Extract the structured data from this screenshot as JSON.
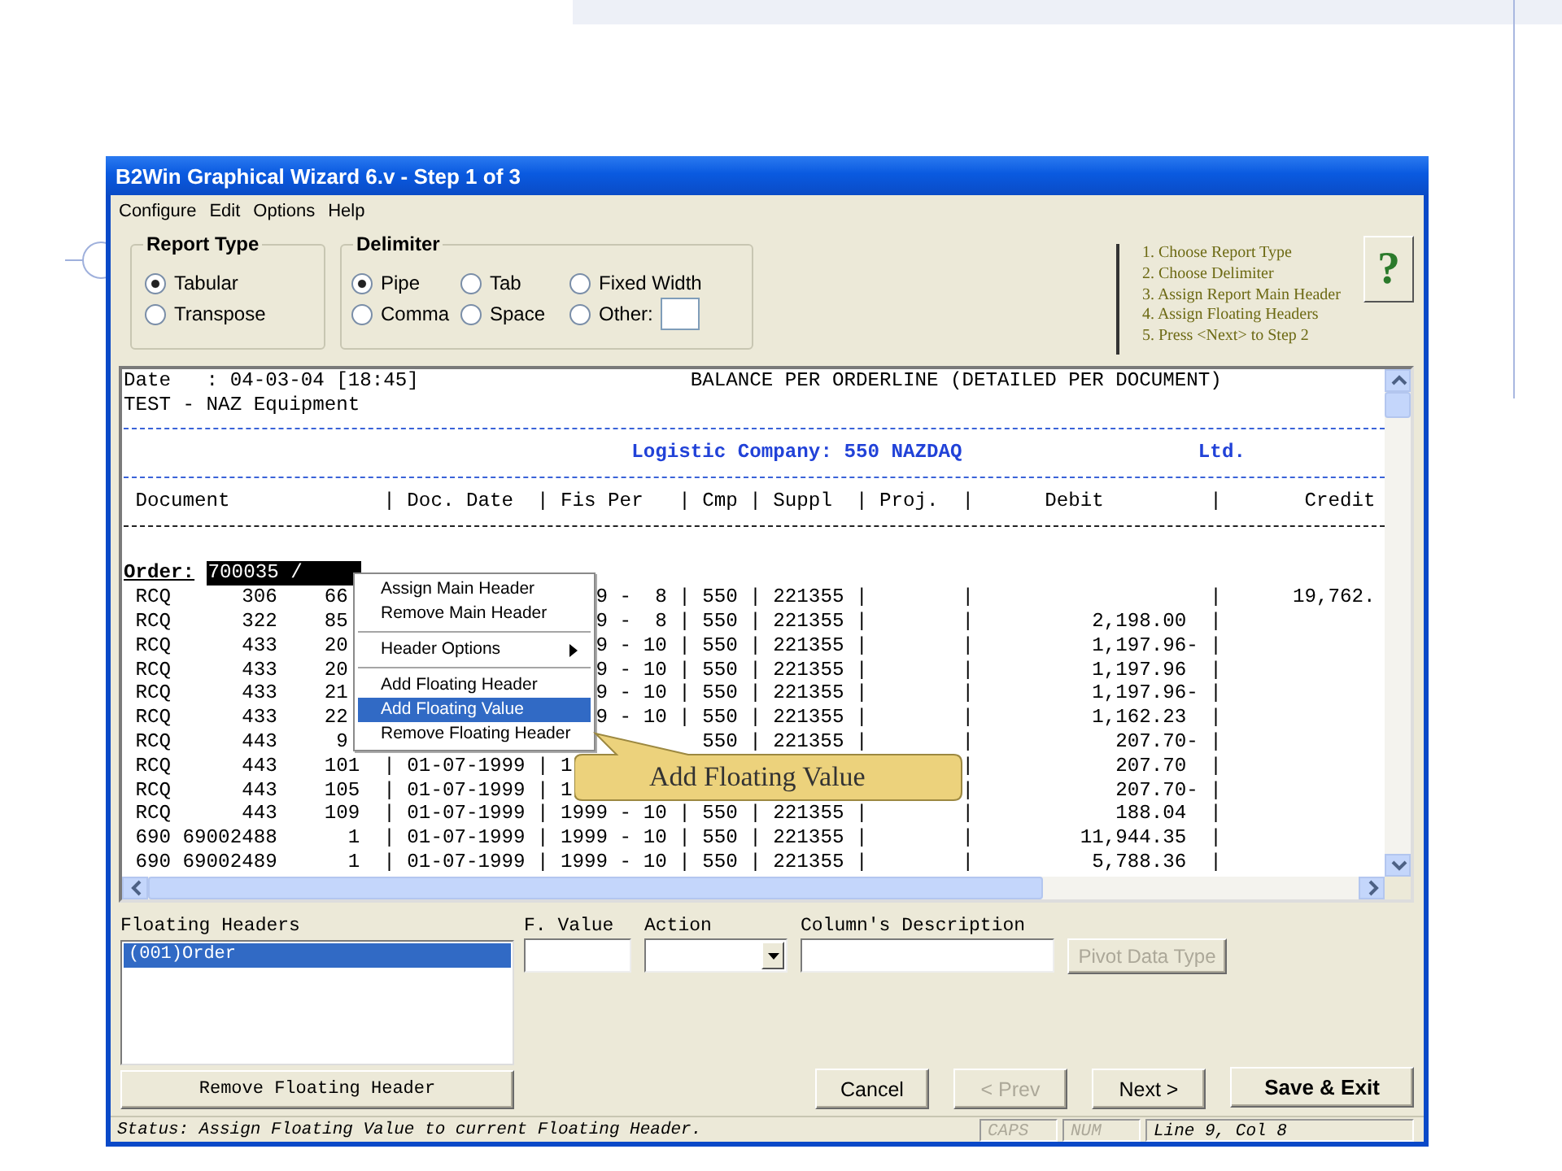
{
  "window": {
    "title": "B2Win Graphical Wizard 6.v - Step 1 of 3"
  },
  "menu_bar": [
    "Configure",
    "Edit",
    "Options",
    "Help"
  ],
  "report_type": {
    "label": "Report Type",
    "options": [
      {
        "label": "Tabular",
        "selected": true
      },
      {
        "label": "Transpose",
        "selected": false
      }
    ]
  },
  "delimiter": {
    "label": "Delimiter",
    "options": [
      {
        "label": "Pipe",
        "selected": true
      },
      {
        "label": "Tab",
        "selected": false
      },
      {
        "label": "Fixed Width",
        "selected": false
      },
      {
        "label": "Comma",
        "selected": false
      },
      {
        "label": "Space",
        "selected": false
      },
      {
        "label": "Other:",
        "selected": false,
        "has_field": true
      }
    ]
  },
  "steps": [
    "1. Choose Report Type",
    "2. Choose Delimiter",
    "3. Assign Report Main Header",
    "4. Assign Floating Headers",
    "5. Press <Next> to Step 2"
  ],
  "help_button": "?",
  "report": {
    "lines": [
      {
        "kind": "text",
        "text": "Date   : 04-03-04 [18:45]                       BALANCE PER ORDERLINE (DETAILED PER DOCUMENT)"
      },
      {
        "kind": "text",
        "text": "TEST - NAZ Equipment"
      },
      {
        "kind": "rule",
        "color": "#3a63d8"
      },
      {
        "kind": "title",
        "text": "                                           Logistic Company: 550 NAZDAQ                    Ltd."
      },
      {
        "kind": "rule",
        "color": "#3a63d8"
      },
      {
        "kind": "text",
        "text": " Document             | Doc. Date  | Fis Per   | Cmp | Suppl  | Proj.  |      Debit         |       Credit"
      },
      {
        "kind": "rule",
        "color": "#222222"
      },
      {
        "kind": "blank"
      },
      {
        "kind": "order",
        "label": "Order:",
        "value": "700035 /",
        "selected": true
      },
      {
        "kind": "menu-gap",
        "left": " RCQ      306    66",
        "right": "9 -  8 | 550 | 221355 |        |                    |      19,762."
      },
      {
        "kind": "menu-gap",
        "left": " RCQ      322    85",
        "right": "9 -  8 | 550 | 221355 |        |          2,198.00  |"
      },
      {
        "kind": "menu-gap",
        "left": " RCQ      433    20",
        "right": "9 - 10 | 550 | 221355 |        |          1,197.96- |"
      },
      {
        "kind": "menu-gap",
        "left": " RCQ      433    20",
        "right": "9 - 10 | 550 | 221355 |        |          1,197.96  |"
      },
      {
        "kind": "menu-gap",
        "left": " RCQ      433    21",
        "right": "9 - 10 | 550 | 221355 |        |          1,197.96- |"
      },
      {
        "kind": "menu-gap",
        "left": " RCQ      433    22",
        "right": "9 - 10 | 550 | 221355 |        |          1,162.23  |"
      },
      {
        "kind": "tail-gap",
        "left": " RCQ      443     9",
        "right": "550 | 221355 |        |            207.70- |"
      },
      {
        "kind": "callout-gap",
        "left": " RCQ      443    101  | 01-07-1999 | 1",
        "right": "|            207.70  |"
      },
      {
        "kind": "callout-gap",
        "left": " RCQ      443    105  | 01-07-1999 | 1",
        "right": "|            207.70- |"
      },
      {
        "kind": "text",
        "text": " RCQ      443    109  | 01-07-1999 | 1999 - 10 | 550 | 221355 |        |            188.04  |"
      },
      {
        "kind": "text",
        "text": " 690 69002488      1  | 01-07-1999 | 1999 - 10 | 550 | 221355 |        |         11,944.35  |"
      },
      {
        "kind": "text",
        "text": " 690 69002489      1  | 01-07-1999 | 1999 - 10 | 550 | 221355 |        |          5,788.36  |"
      }
    ]
  },
  "context_menu": [
    {
      "kind": "item",
      "label": "Assign Main Header",
      "selected": false
    },
    {
      "kind": "item",
      "label": "Remove Main Header",
      "selected": false
    },
    {
      "kind": "separator"
    },
    {
      "kind": "submenu",
      "label": "Header Options",
      "selected": false
    },
    {
      "kind": "separator"
    },
    {
      "kind": "item",
      "label": "Add Floating Header",
      "selected": false
    },
    {
      "kind": "item",
      "label": "Add Floating Value",
      "selected": true
    },
    {
      "kind": "item",
      "label": "Remove Floating Header",
      "selected": false
    }
  ],
  "callout": "Add Floating Value",
  "floating_headers": {
    "label": "Floating Headers",
    "items": [
      {
        "label": "(001)Order",
        "selected": true
      }
    ]
  },
  "f_value": {
    "label": "F. Value"
  },
  "action": {
    "label": "Action"
  },
  "column_description": {
    "label": "Column's Description"
  },
  "pivot_button": {
    "label": "Pivot Data Type",
    "disabled": true
  },
  "remove_button": "Remove Floating Header",
  "buttons": [
    {
      "label": "Cancel",
      "kind": "normal",
      "disabled": false
    },
    {
      "label": "< Prev",
      "kind": "normal",
      "disabled": true
    },
    {
      "label": "Next >",
      "kind": "normal",
      "disabled": false
    },
    {
      "label": "Save & Exit",
      "kind": "primary",
      "disabled": false
    }
  ],
  "status_bar": {
    "text": "Status: Assign Floating Value to current Floating Header.",
    "indicators": [
      {
        "label": "CAPS",
        "disabled": true
      },
      {
        "label": "NUM",
        "disabled": true
      }
    ],
    "position": "Line 9, Col 8"
  }
}
